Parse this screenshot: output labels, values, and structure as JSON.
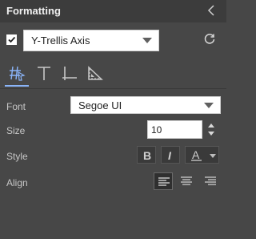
{
  "panel": {
    "title": "Formatting"
  },
  "axis_selector": {
    "checked": true,
    "value": "Y-Trellis Axis"
  },
  "tabs": [
    {
      "name": "axis-format",
      "active": true
    },
    {
      "name": "text",
      "active": false
    },
    {
      "name": "axis-lines",
      "active": false
    },
    {
      "name": "ruler",
      "active": false
    }
  ],
  "font": {
    "label": "Font",
    "value": "Segoe UI"
  },
  "size": {
    "label": "Size",
    "value": "10"
  },
  "style": {
    "label": "Style",
    "bold_label": "B",
    "italic_label": "I",
    "color_label": "A"
  },
  "align": {
    "label": "Align",
    "selected": "left"
  }
}
